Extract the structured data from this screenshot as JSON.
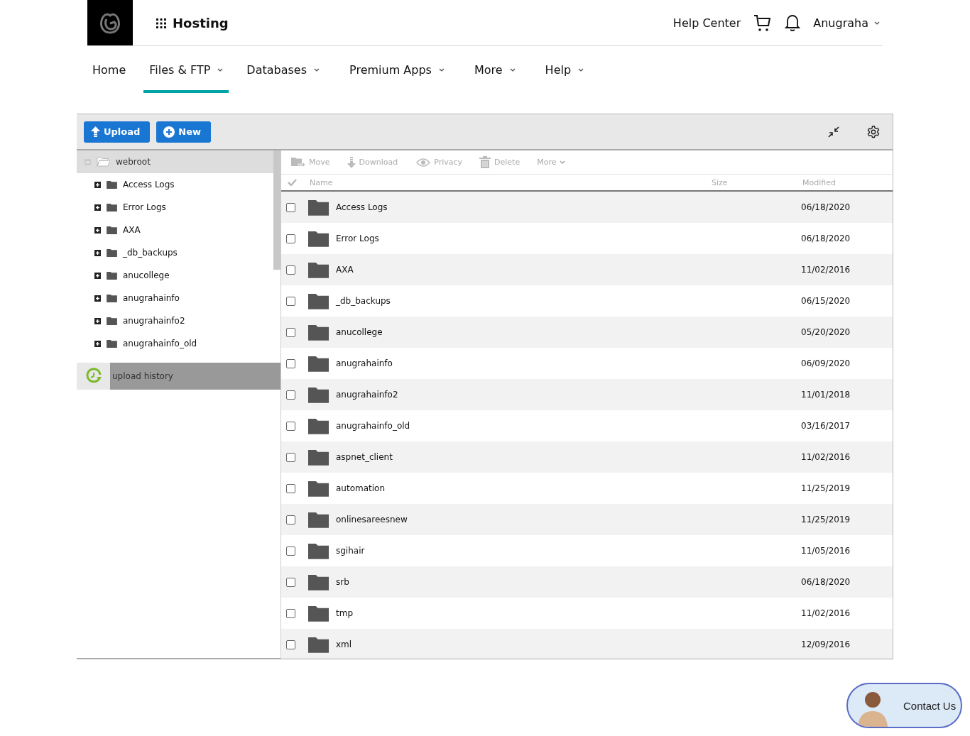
{
  "header": {
    "app_title": "Hosting",
    "help_center": "Help Center",
    "user": "Anugraha"
  },
  "nav": [
    {
      "label": "Home",
      "selected": false,
      "dropdown": false
    },
    {
      "label": "Files & FTP",
      "selected": true,
      "dropdown": true
    },
    {
      "label": "Databases",
      "selected": false,
      "dropdown": true
    },
    {
      "label": "Premium Apps",
      "selected": false,
      "dropdown": true
    },
    {
      "label": "More",
      "selected": false,
      "dropdown": true
    },
    {
      "label": "Help",
      "selected": false,
      "dropdown": true
    }
  ],
  "toolbar": {
    "upload": "Upload",
    "new": "New"
  },
  "tree": {
    "label": "webroot",
    "expanded": true,
    "children": [
      {
        "label": "Access Logs",
        "expanded": false
      },
      {
        "label": "Error Logs",
        "expanded": false
      },
      {
        "label": "AXA",
        "expanded": false
      },
      {
        "label": "_db_backups",
        "expanded": false
      },
      {
        "label": "anucollege",
        "expanded": false
      },
      {
        "label": "anugrahainfo",
        "expanded": false
      },
      {
        "label": "anugrahainfo2",
        "expanded": false
      },
      {
        "label": "anugrahainfo_old",
        "expanded": false
      }
    ]
  },
  "upload_history": "upload history",
  "actions": [
    {
      "kind": "move",
      "label": "Move",
      "disabled": true
    },
    {
      "kind": "download",
      "label": "Download",
      "disabled": true
    },
    {
      "kind": "privacy",
      "label": "Privacy",
      "disabled": true
    },
    {
      "kind": "delete",
      "label": "Delete",
      "disabled": true
    },
    {
      "kind": "more",
      "label": "More",
      "disabled": true
    }
  ],
  "columns": [
    "Name",
    "Size",
    "Modified"
  ],
  "rows": [
    {
      "name": "Access Logs",
      "modified": "06/18/2020",
      "checked": false
    },
    {
      "name": "Error Logs",
      "modified": "06/18/2020",
      "checked": false
    },
    {
      "name": "AXA",
      "modified": "11/02/2016",
      "checked": false
    },
    {
      "name": "_db_backups",
      "modified": "06/15/2020",
      "checked": false
    },
    {
      "name": "anucollege",
      "modified": "05/20/2020",
      "checked": false
    },
    {
      "name": "anugrahainfo",
      "modified": "06/09/2020",
      "checked": false
    },
    {
      "name": "anugrahainfo2",
      "modified": "11/01/2018",
      "checked": false
    },
    {
      "name": "anugrahainfo_old",
      "modified": "03/16/2017",
      "checked": false
    },
    {
      "name": "aspnet_client",
      "modified": "11/02/2016",
      "checked": false
    },
    {
      "name": "automation",
      "modified": "11/25/2019",
      "checked": false
    },
    {
      "name": "onlinesareesnew",
      "modified": "11/25/2019",
      "checked": false
    },
    {
      "name": "sgihair",
      "modified": "11/05/2016",
      "checked": false
    },
    {
      "name": "srb",
      "modified": "06/18/2020",
      "checked": false
    },
    {
      "name": "tmp",
      "modified": "11/02/2016",
      "checked": false
    },
    {
      "name": "xml",
      "modified": "12/09/2016",
      "checked": false
    }
  ],
  "contact": "Contact Us"
}
